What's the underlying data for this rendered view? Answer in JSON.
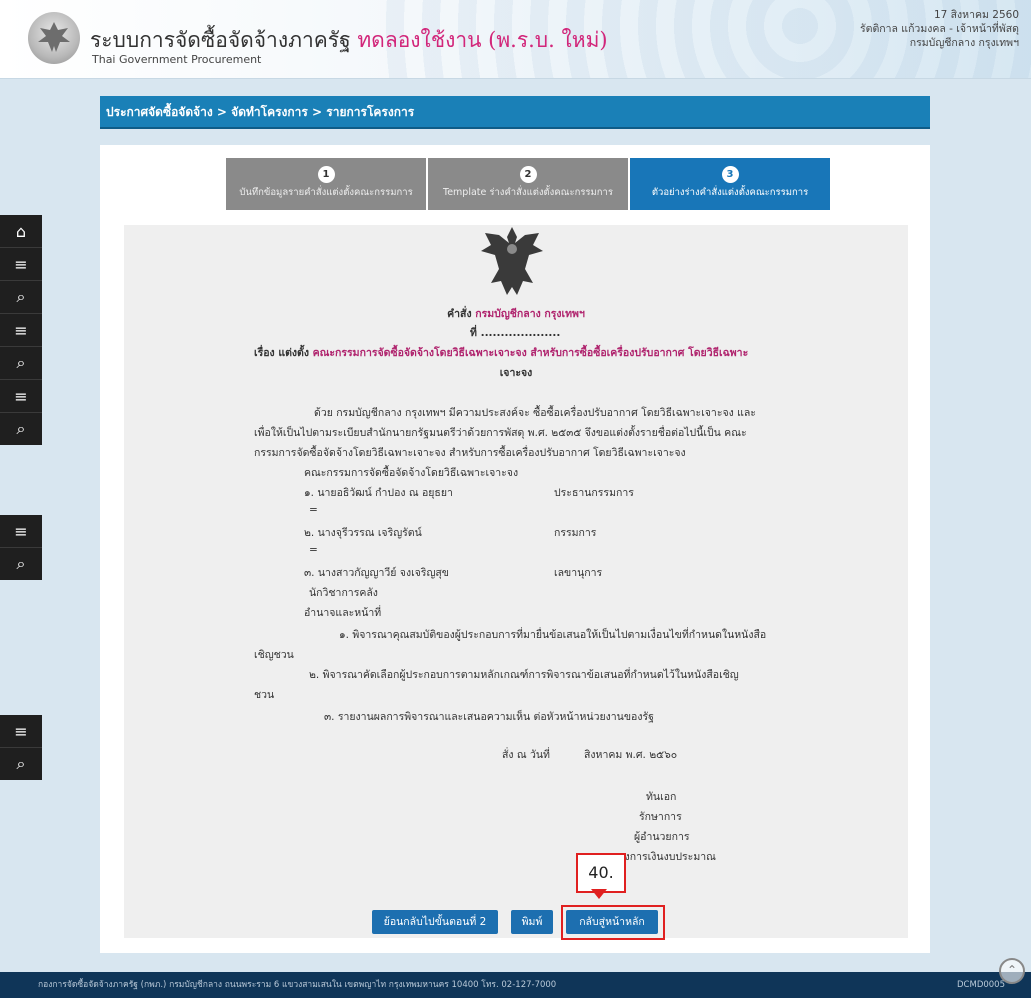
{
  "header": {
    "title": "ระบบการจัดซื้อจัดจ้างภาครัฐ",
    "trial_label": "ทดลองใช้งาน (พ.ร.บ. ใหม่)",
    "subtitle": "Thai Government Procurement",
    "date": "17 สิงหาคม 2560",
    "user": "รัตติกาล แก้วมงคล - เจ้าหน้าที่พัสดุ",
    "department": "กรมบัญชีกลาง กรุงเทพฯ"
  },
  "breadcrumb": "ประกาศจัดซื้อจัดจ้าง > จัดทำโครงการ > รายการโครงการ",
  "steps": [
    {
      "num": "1",
      "label": "บันทึกข้อมูลรายคำสั่งแต่งตั้งคณะกรรมการ"
    },
    {
      "num": "2",
      "label": "Template ร่างคำสั่งแต่งตั้งคณะกรรมการ"
    },
    {
      "num": "3",
      "label": "ตัวอย่างร่างคำสั่งแต่งตั้งคณะกรรมการ"
    }
  ],
  "document": {
    "order_prefix": "คำสั่ง",
    "order_org": "กรมบัญชีกลาง กรุงเทพฯ",
    "number_line": "ที่ ....................",
    "subject_prefix": "เรื่อง แต่งตั้ง",
    "subject_line1": "คณะกรรมการจัดซื้อจัดจ้างโดยวิธีเฉพาะเจาะจง สำหรับการซื้อซื้อเครื่องปรับอากาศ โดยวิธีเฉพาะ",
    "subject_line2": "เจาะจง",
    "para1_line1": "ด้วย กรมบัญชีกลาง กรุงเทพฯ มีความประสงค์จะ ซื้อซื้อเครื่องปรับอากาศ โดยวิธีเฉพาะเจาะจง และ",
    "para1_line2": "เพื่อให้เป็นไปตามระเบียบสำนักนายกรัฐมนตรีว่าด้วยการพัสดุ พ.ศ. ๒๕๓๕ จึงขอแต่งตั้งรายชื่อต่อไปนี้เป็น คณะ",
    "para1_line3": "กรรมการจัดซื้อจัดจ้างโดยวิธีเฉพาะเจาะจง สำหรับการซื้อเครื่องปรับอากาศ โดยวิธีเฉพาะเจาะจง",
    "committee_heading": "คณะกรรมการจัดซื้อจัดจ้างโดยวิธีเฉพาะเจาะจง",
    "members": [
      {
        "name": "๑. นายอธิวัฒน์ กำปอง ณ อยุธยา",
        "role": "ประธานกรรมการ",
        "note": "="
      },
      {
        "name": "๒. นางจุรีวรรณ เจริญรัตน์",
        "role": "กรรมการ",
        "note": "="
      },
      {
        "name": "๓. นางสาวกัญญาวีย์ จงเจริญสุข",
        "role": "เลขานุการ",
        "note": "นักวิชาการคลัง"
      }
    ],
    "duties_heading": "อำนาจและหน้าที่",
    "duty1_line1": "๑. พิจารณาคุณสมบัติของผู้ประกอบการที่มายื่นข้อเสนอให้เป็นไปตามเงื่อนไขที่กำหนดในหนังสือ",
    "duty1_line2": "เชิญชวน",
    "duty2_line1": "๒. พิจารณาคัดเลือกผู้ประกอบการตามหลักเกณฑ์การพิจารณาข้อเสนอที่กำหนดไว้ในหนังสือเชิญ",
    "duty2_line2": "ชวน",
    "duty3": "๓. รายงานผลการพิจารณาและเสนอความเห็น ต่อหัวหน้าหน่วยงานของรัฐ",
    "order_date_label": "สั่ง ณ วันที่",
    "order_date": "สิงหาคม พ.ศ. ๒๕๖๐",
    "signatures": [
      "ทันเอก",
      "รักษาการ",
      "ผู้อำนวยการ",
      "กองการเงินงบประมาณ"
    ]
  },
  "buttons": {
    "back_step": "ย้อนกลับไปขั้นตอนที่ 2",
    "print": "พิมพ์",
    "home": "กลับสู่หน้าหลัก"
  },
  "annotation": {
    "callout_label": "40."
  },
  "footer": {
    "address": "กองการจัดซื้อจัดจ้างภาครัฐ (กพภ.) กรมบัญชีกลาง ถนนพระราม 6 แขวงสามเสนใน เขตพญาไท กรุงเทพมหานคร 10400 โทร. 02-127-7000",
    "code": "DCMD0005"
  }
}
